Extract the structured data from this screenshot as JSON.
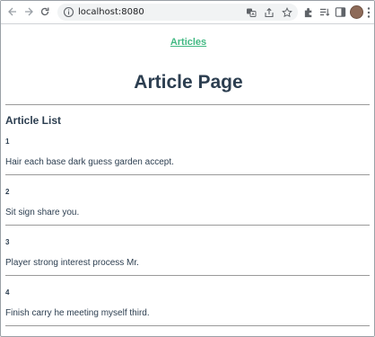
{
  "browser": {
    "url": "localhost:8080",
    "icons": [
      "back-arrow-icon",
      "forward-arrow-icon",
      "reload-icon",
      "info-icon",
      "translate-icon",
      "share-icon",
      "star-icon",
      "extensions-icon",
      "reading-list-icon",
      "side-panel-icon",
      "avatar",
      "menu-icon"
    ]
  },
  "nav": {
    "articles_link": "Articles"
  },
  "page": {
    "title": "Article Page",
    "list_title": "Article List"
  },
  "articles": [
    {
      "id": "1",
      "text": "Hair each base dark guess garden accept."
    },
    {
      "id": "2",
      "text": "Sit sign share you."
    },
    {
      "id": "3",
      "text": "Player strong interest process Mr."
    },
    {
      "id": "4",
      "text": "Finish carry he meeting myself third."
    }
  ],
  "colors": {
    "link": "#42b983",
    "text": "#2c3e50",
    "avatar": "#8d6a58"
  }
}
